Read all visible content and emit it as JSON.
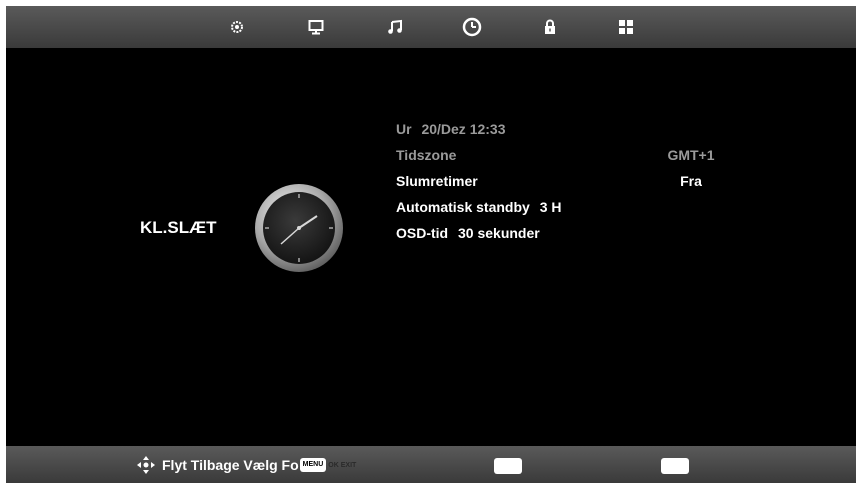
{
  "top_menu": {
    "tabs": [
      {
        "id": "picture",
        "icon": "gear-icon",
        "active": false
      },
      {
        "id": "display",
        "icon": "monitor-icon",
        "active": false
      },
      {
        "id": "sound",
        "icon": "music-note-icon",
        "active": false
      },
      {
        "id": "time",
        "icon": "clock-icon",
        "active": true
      },
      {
        "id": "lock",
        "icon": "lock-icon",
        "active": false
      },
      {
        "id": "setup",
        "icon": "grid-icon",
        "active": false
      }
    ]
  },
  "section": {
    "title": "KL.SLÆT",
    "icon": "clock-icon"
  },
  "settings": {
    "clock": {
      "label": "Ur",
      "value": "20/Dez 12:33",
      "dimmed": true
    },
    "timezone": {
      "label": "Tidszone",
      "value": "GMT+1",
      "dimmed": true
    },
    "sleep_timer": {
      "label": "Slumretimer",
      "value": "Fra",
      "dimmed": false
    },
    "auto_standby": {
      "label": "Automatisk standby",
      "value": "3 H",
      "dimmed": false
    },
    "osd_time": {
      "label": "OSD-tid",
      "value": "30 sekunder",
      "dimmed": false
    }
  },
  "bottom_bar": {
    "nav_icon": "dpad-arrows-icon",
    "hint_text": "Flyt Tilbage Vælg Fo",
    "menu_key": "MENU",
    "ok_exit_tag": "OK EXIT"
  },
  "colors": {
    "background": "#000000",
    "bar": "#4a4a4a",
    "text_active": "#ffffff",
    "text_dimmed": "#9a9a9a"
  }
}
